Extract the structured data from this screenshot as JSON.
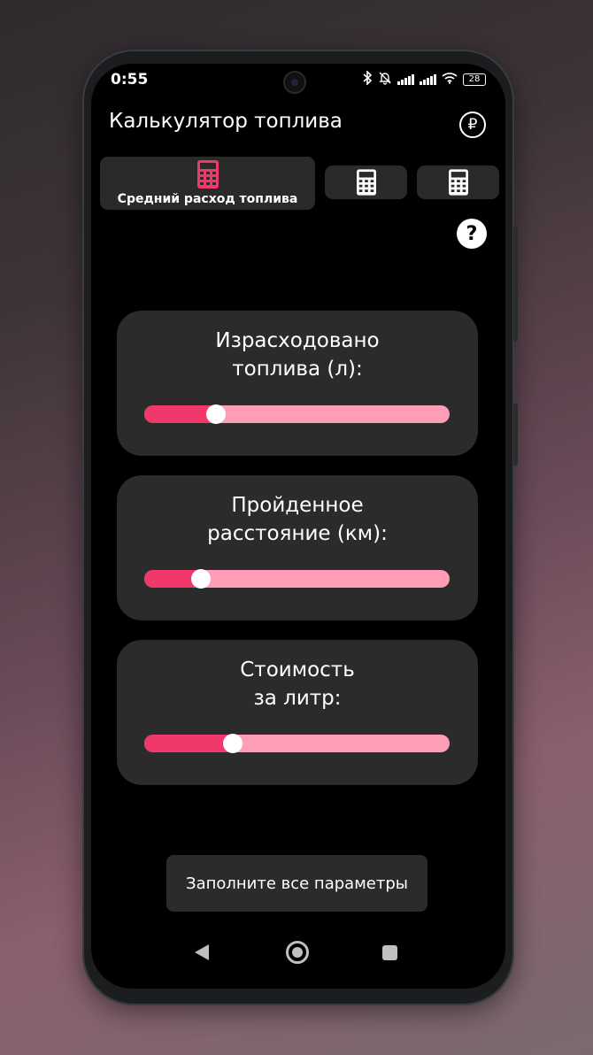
{
  "status_bar": {
    "time": "0:55",
    "battery": "28",
    "icons": [
      "bluetooth-icon",
      "bell-off-icon",
      "signal-icon",
      "signal-icon",
      "wifi-icon",
      "battery-icon"
    ]
  },
  "header": {
    "title": "Калькулятор топлива",
    "currency_symbol": "₽"
  },
  "tabs": [
    {
      "label": "Средний расход топлива",
      "active": true,
      "icon": "calculator-icon"
    },
    {
      "label": "",
      "active": false,
      "icon": "calculator-icon"
    },
    {
      "label": "",
      "active": false,
      "icon": "calculator-icon"
    }
  ],
  "help_symbol": "?",
  "sliders": [
    {
      "label": "Израсходовано\nтоплива (л):",
      "fraction": 0.235
    },
    {
      "label": "Пройденное\nрасстояние (км):",
      "fraction": 0.185
    },
    {
      "label": "Стоимость\nза литр:",
      "fraction": 0.29
    }
  ],
  "hint": "Заполните все параметры",
  "colors": {
    "accent": "#f0386b",
    "track": "#ff9db6",
    "card": "#2b2b2b",
    "background": "#000000"
  },
  "nav_icons": [
    "back-icon",
    "home-icon",
    "recents-icon"
  ]
}
